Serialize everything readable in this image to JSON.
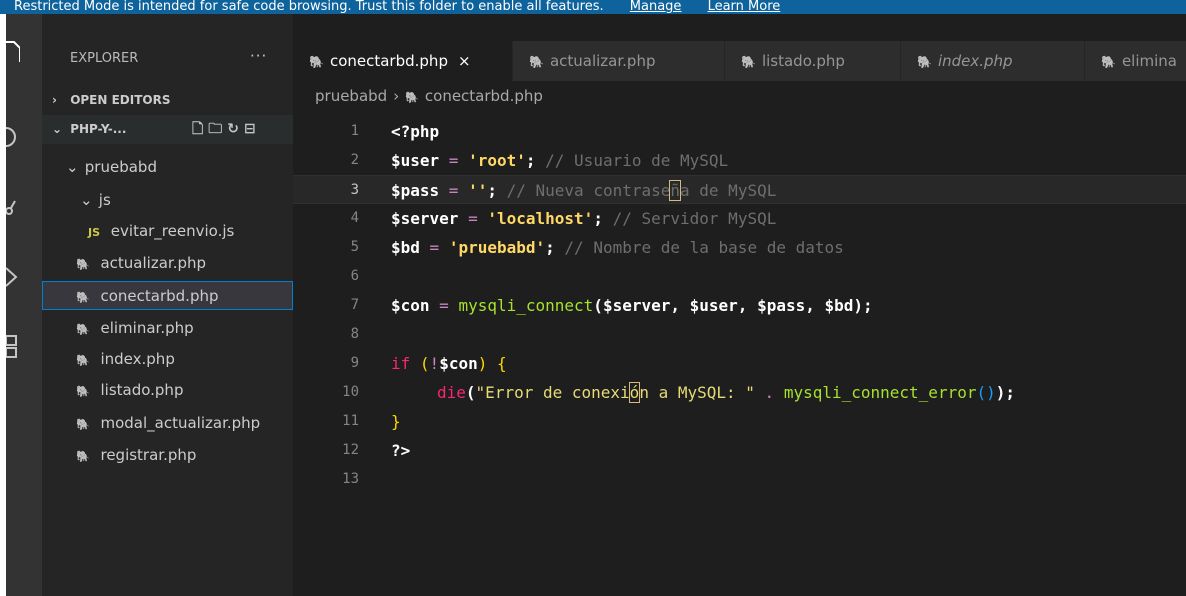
{
  "banner": {
    "text": "Restricted Mode is intended for safe code browsing. Trust this folder to enable all features.",
    "manage": "Manage",
    "learn_more": "Learn More"
  },
  "sidebar": {
    "title": "EXPLORER",
    "more": "···",
    "open_editors": "OPEN EDITORS",
    "project": "PHP-Y-...",
    "tree": [
      {
        "label": "pruebabd",
        "kind": "folder"
      },
      {
        "label": "js",
        "kind": "folder"
      },
      {
        "label": "evitar_reenvio.js",
        "kind": "js"
      },
      {
        "label": "actualizar.php",
        "kind": "php"
      },
      {
        "label": "conectarbd.php",
        "kind": "php",
        "active": true
      },
      {
        "label": "eliminar.php",
        "kind": "php"
      },
      {
        "label": "index.php",
        "kind": "php"
      },
      {
        "label": "listado.php",
        "kind": "php"
      },
      {
        "label": "modal_actualizar.php",
        "kind": "php"
      },
      {
        "label": "registrar.php",
        "kind": "php"
      }
    ],
    "js_badge": "JS"
  },
  "tabs": [
    {
      "label": "conectarbd.php",
      "active": true
    },
    {
      "label": "actualizar.php"
    },
    {
      "label": "listado.php"
    },
    {
      "label": "index.php",
      "italic": true
    },
    {
      "label": "elimina"
    }
  ],
  "tab_close": "×",
  "breadcrumb": {
    "folder": "pruebabd",
    "sep": "›",
    "file": "conectarbd.php"
  },
  "code": {
    "line_numbers": [
      "1",
      "2",
      "3",
      "4",
      "5",
      "6",
      "7",
      "8",
      "9",
      "10",
      "11",
      "12",
      "13"
    ],
    "l1": "<?php",
    "l2_var": "$user",
    "l2_eq": " = ",
    "l2_str": "'root'",
    "l2_semi": ";",
    "l2_com": " // Usuario de MySQL",
    "l3_var": "$pass",
    "l3_eq": " = ",
    "l3_str": "''",
    "l3_semi": ";",
    "l3_com_a": " // Nueva contrase",
    "l3_com_cursor": "ñ",
    "l3_com_b": "a de MySQL",
    "l4_var": "$server",
    "l4_eq": " = ",
    "l4_str": "'localhost'",
    "l4_semi": ";",
    "l4_com": " // Servidor MySQL",
    "l5_var": "$bd",
    "l5_eq": " = ",
    "l5_str": "'pruebabd'",
    "l5_semi": ";",
    "l5_com": " // Nombre de la base de datos",
    "l7_var": "$con",
    "l7_eq": " = ",
    "l7_fn": "mysqli_connect",
    "l7_open": "(",
    "l7_args": "$server, $user, $pass, $bd",
    "l7_close": ");",
    "l9_if": "if",
    "l9_sp": " ",
    "l9_open": "(",
    "l9_not": "!",
    "l9_var": "$con",
    "l9_close": ")",
    "l9_brace": " {",
    "l10_die": "die",
    "l10_open": "(",
    "l10_str_a": "\"Error de conexi",
    "l10_str_cursor": "ó",
    "l10_str_b": "n a MySQL: \"",
    "l10_dot": " . ",
    "l10_fn": "mysqli_connect_error",
    "l10_par": "()",
    "l10_close": ");",
    "l11": "}",
    "l12": "?>"
  },
  "colors": {
    "banner": "#0e639c",
    "sidebar": "#252526",
    "editor": "#1e1e1e",
    "php_icon": "#a074c4",
    "js_icon": "#cbcb41",
    "string": "#ffd866",
    "function": "#a6e22e"
  }
}
